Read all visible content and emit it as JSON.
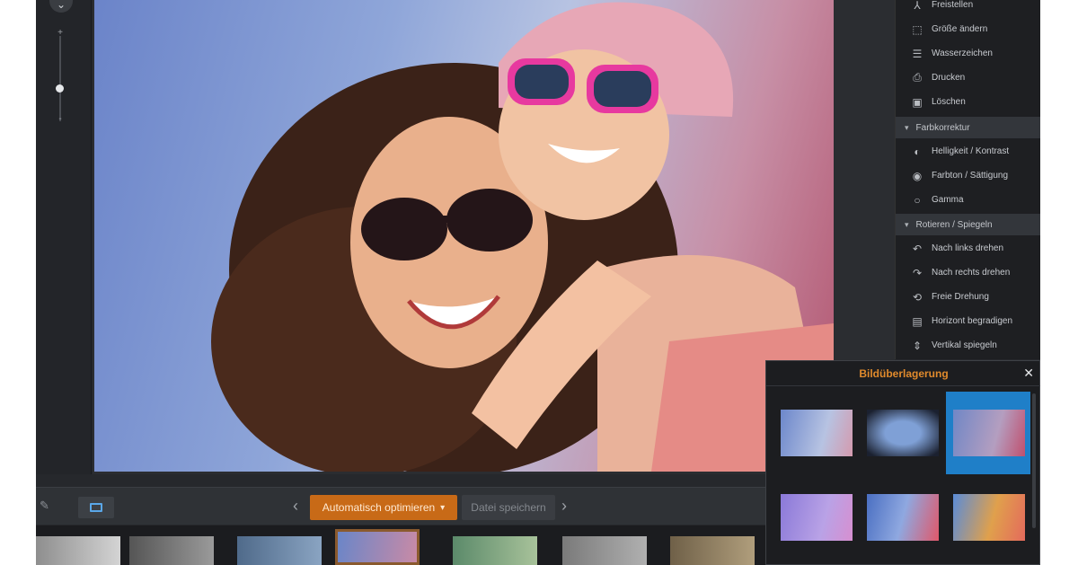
{
  "zoom": {
    "plus": "+",
    "minus": "-",
    "toggle": "⌄"
  },
  "right_panel": {
    "items_top": [
      {
        "label": "Freistellen",
        "icon": "crop-icon",
        "glyph": "⅄"
      },
      {
        "label": "Größe ändern",
        "icon": "resize-icon",
        "glyph": "⬚"
      },
      {
        "label": "Wasserzeichen",
        "icon": "watermark-icon",
        "glyph": "☰"
      },
      {
        "label": "Drucken",
        "icon": "print-icon",
        "glyph": "⎙"
      },
      {
        "label": "Löschen",
        "icon": "trash-icon",
        "glyph": "🗑"
      }
    ],
    "section_color": "Farbkorrektur",
    "items_color": [
      {
        "label": "Helligkeit / Kontrast",
        "icon": "contrast-icon",
        "glyph": "◐"
      },
      {
        "label": "Farbton / Sättigung",
        "icon": "hue-icon",
        "glyph": "◉"
      },
      {
        "label": "Gamma",
        "icon": "gamma-icon",
        "glyph": "○"
      }
    ],
    "section_rotate": "Rotieren / Spiegeln",
    "items_rotate": [
      {
        "label": "Nach links drehen",
        "icon": "rotate-left-icon",
        "glyph": "↶"
      },
      {
        "label": "Nach rechts drehen",
        "icon": "rotate-right-icon",
        "glyph": "↷"
      },
      {
        "label": "Freie Drehung",
        "icon": "free-rotate-icon",
        "glyph": "⟲"
      },
      {
        "label": "Horizont begradigen",
        "icon": "horizon-icon",
        "glyph": "▤"
      },
      {
        "label": "Vertikal spiegeln",
        "icon": "flip-vertical-icon",
        "glyph": "⇕"
      }
    ]
  },
  "toolbar": {
    "auto_optimize": "Automatisch optimieren",
    "dropdown_arrow": "▾",
    "save_file": "Datei speichern",
    "prev": "‹",
    "next": "›"
  },
  "overlay": {
    "title": "Bildüberlagerung",
    "close": "✕",
    "selected_index": 2
  },
  "colors": {
    "accent_orange": "#c86a17",
    "title_orange": "#e08a2c",
    "selection_blue": "#1f7fc8"
  }
}
